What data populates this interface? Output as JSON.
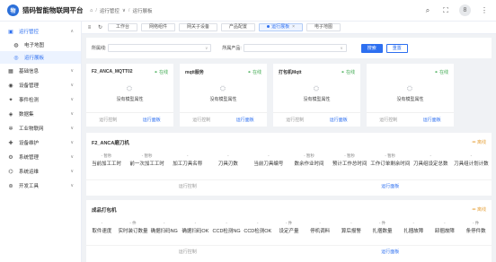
{
  "app": {
    "logo_text": "物",
    "title": "猎码智能物联网平台"
  },
  "breadcrumb": {
    "home_icon": "home-icon",
    "level1": "运行管控",
    "level1_chevron": "∨",
    "sep": "/",
    "level2": "运行展板"
  },
  "header_icons": [
    "search-icon",
    "fullscreen-icon",
    "avatar",
    "more-icon"
  ],
  "avatar_text": "8",
  "sidebar": {
    "items": [
      {
        "label": "运行管控",
        "icon": "monitor-icon",
        "active": true,
        "expanded": true
      },
      {
        "label": "基础信息",
        "icon": "grid-icon"
      },
      {
        "label": "设备管理",
        "icon": "device-icon"
      },
      {
        "label": "事件检测",
        "icon": "event-icon"
      },
      {
        "label": "数据集",
        "icon": "dataset-icon"
      },
      {
        "label": "工业物联网",
        "icon": "iot-icon"
      },
      {
        "label": "设备维护",
        "icon": "maintenance-icon"
      },
      {
        "label": "系统管理",
        "icon": "settings-icon"
      },
      {
        "label": "系统运维",
        "icon": "ops-icon"
      },
      {
        "label": "开发工具",
        "icon": "tool-icon"
      }
    ],
    "subitems": [
      {
        "label": "电子地图",
        "icon": "map-icon"
      },
      {
        "label": "运行展板",
        "icon": "board-icon",
        "selected": true
      }
    ]
  },
  "tabs": [
    {
      "label": "工作台"
    },
    {
      "label": "网络组件"
    },
    {
      "label": "网关子设备"
    },
    {
      "label": "产品配置"
    },
    {
      "label": "运行展板",
      "active": true,
      "closable": true
    },
    {
      "label": "电子地图"
    }
  ],
  "filters": {
    "line_label": "所属线:",
    "product_label": "所属产品:",
    "search_button": "搜索",
    "reset_button": "重置"
  },
  "cards": [
    {
      "title": "F2_ANCA_MQTT02",
      "status": "在线",
      "empty": "没有模型属性",
      "action1": "运行控制",
      "action2": "运行面板"
    },
    {
      "title": "mqtt服务",
      "status": "在线",
      "empty": "没有模型属性",
      "action1": "运行控制",
      "action2": "运行面板"
    },
    {
      "title": "打包机Mqtt",
      "status": "在线",
      "empty": "没有模型属性",
      "action1": "运行控制",
      "action2": "运行面板"
    },
    {
      "title": "",
      "status": "在线",
      "empty": "没有模型属性",
      "action1": "运行控制",
      "action2": "运行面板"
    }
  ],
  "panels": [
    {
      "title": "F2_ANCA磨刀机",
      "status": "离线",
      "metrics": [
        {
          "value": "- 暂秒",
          "label": "当前加工工时"
        },
        {
          "value": "- 暂秒",
          "label": "前一次加工工时"
        },
        {
          "value": "-",
          "label": "加工刀具名称"
        },
        {
          "value": "-",
          "label": "刀具刃数"
        },
        {
          "value": "-",
          "label": "当前刀具编号"
        },
        {
          "value": "- 暂秒",
          "label": "数余作业时间"
        },
        {
          "value": "- 暂秒",
          "label": "预计工作总时间"
        },
        {
          "value": "- 暂秒",
          "label": "工作订单剩余时间"
        },
        {
          "value": "-",
          "label": "刀具组设定总数"
        },
        {
          "value": "-",
          "label": "刀具组计划计数"
        }
      ],
      "action1": "运行控制",
      "action2": "运行面板"
    },
    {
      "title": "成品打包机",
      "status": "离线",
      "metrics": [
        {
          "value": "-",
          "label": "取件速度"
        },
        {
          "value": "- 件",
          "label": "实时装订数量"
        },
        {
          "value": "-",
          "label": "确据扫码NG"
        },
        {
          "value": "-",
          "label": "确据扫码OK"
        },
        {
          "value": "-",
          "label": "CCD检测NG"
        },
        {
          "value": "-",
          "label": "CCD检测OK"
        },
        {
          "value": "- 件",
          "label": "设定产量"
        },
        {
          "value": "-",
          "label": "停机调料"
        },
        {
          "value": "-",
          "label": "算后报警"
        },
        {
          "value": "- 件",
          "label": "扎捆数量"
        },
        {
          "value": "-",
          "label": "扎捆故障"
        },
        {
          "value": "-",
          "label": "卸捆故障"
        },
        {
          "value": "- 件",
          "label": "条停件数"
        }
      ],
      "action1": "运行控制",
      "action2": "运行面板"
    }
  ]
}
